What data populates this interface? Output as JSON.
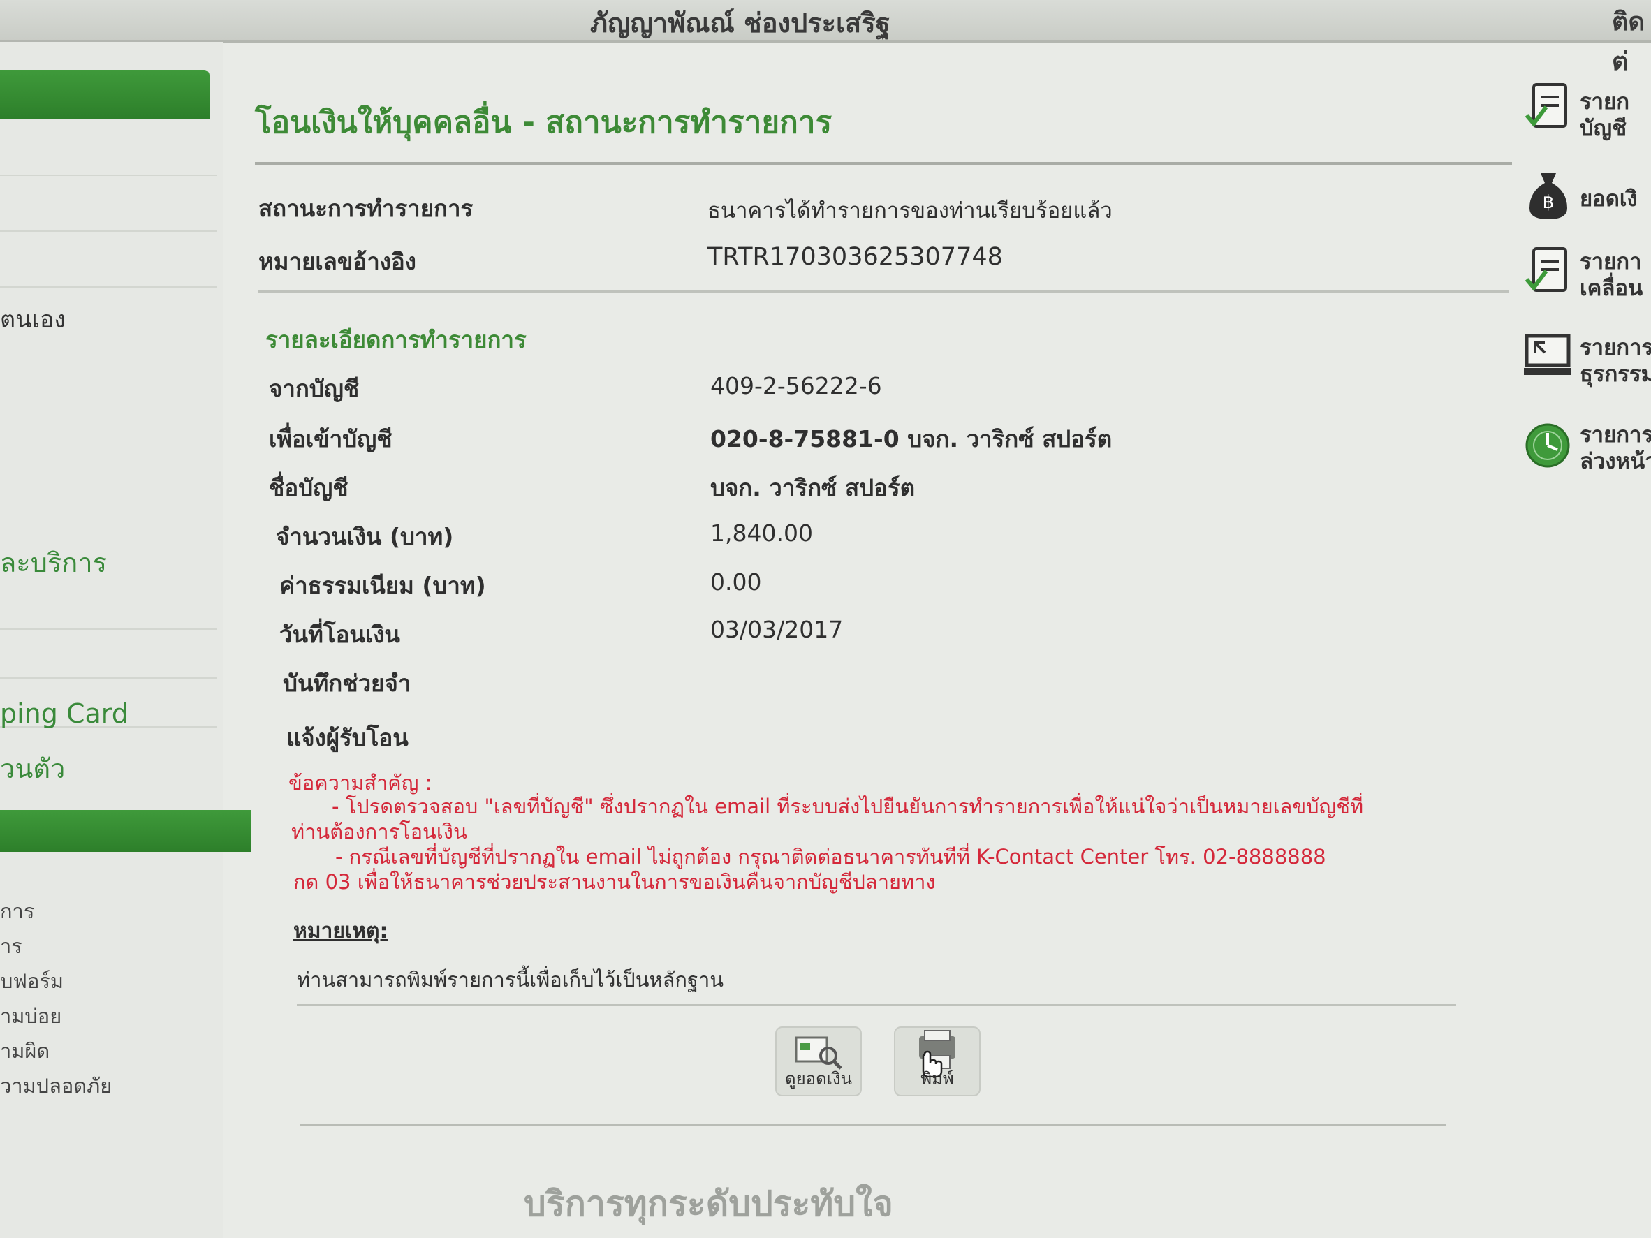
{
  "topbar": {
    "user_name": "ภัญญาพัณณ์ ช่องประเสริฐ",
    "contact": "ติดต่"
  },
  "sidebar": {
    "items": [
      {
        "label": "ตนเอง"
      },
      {
        "label": "ละบริการ"
      },
      {
        "label": "ping Card"
      },
      {
        "label": "วนตัว"
      },
      {
        "label": "การ"
      },
      {
        "label": "าร"
      },
      {
        "label": "บฟอร์ม"
      },
      {
        "label": "ามบ่อย"
      },
      {
        "label": "ามผิด"
      },
      {
        "label": "วามปลอดภัย"
      }
    ]
  },
  "main": {
    "title": "โอนเงินให้บุคคลอื่น - สถานะการทำรายการ",
    "status_label": "สถานะการทำรายการ",
    "status_value": "ธนาคารได้ทำรายการของท่านเรียบร้อยแล้ว",
    "ref_label": "หมายเลขอ้างอิง",
    "ref_value": "TRTR170303625307748",
    "details_title": "รายละเอียดการทำรายการ",
    "details": [
      {
        "label": "จากบัญชี",
        "value": "409-2-56222-6"
      },
      {
        "label": "เพื่อเข้าบัญชี",
        "value": "020-8-75881-0",
        "value_extra": "บจก. วาริกซ์ สปอร์ต"
      },
      {
        "label": "ชื่อบัญชี",
        "value": "บจก. วาริกซ์ สปอร์ต"
      },
      {
        "label": "จำนวนเงิน (บาท)",
        "value": "1,840.00"
      },
      {
        "label": "ค่าธรรมเนียม (บาท)",
        "value": "0.00"
      },
      {
        "label": "วันที่โอนเงิน",
        "value": "03/03/2017"
      },
      {
        "label": "บันทึกช่วยจำ",
        "value": ""
      },
      {
        "label": "แจ้งผู้รับโอน",
        "value": ""
      }
    ],
    "important_title": "ข้อความสำคัญ :",
    "important_lines": [
      "- โปรดตรวจสอบ \"เลขที่บัญชี\" ซึ่งปรากฏใน email ที่ระบบส่งไปยืนยันการทำรายการเพื่อให้แน่ใจว่าเป็นหมายเลขบัญชีที่",
      "ท่านต้องการโอนเงิน",
      "- กรณีเลขที่บัญชีที่ปรากฏใน email ไม่ถูกต้อง กรุณาติดต่อธนาคารทันทีที่ K-Contact Center โทร. 02-8888888",
      "กด 03 เพื่อให้ธนาคารช่วยประสานงานในการขอเงินคืนจากบัญชีปลายทาง"
    ],
    "note_title": "หมายเหตุ:",
    "note_text": "ท่านสามารถพิมพ์รายการนี้เพื่อเก็บไว้เป็นหลักฐาน",
    "buttons": {
      "view_balance": "ดูยอดเงิน",
      "print": "พิมพ์"
    },
    "footer_slogan": "บริการทุกระดับประทับใจ"
  },
  "right_menu": [
    {
      "line1": "รายก",
      "line2": "บัญชี",
      "icon": "document-check-icon"
    },
    {
      "line1": "ยอดเงิ",
      "line2": "",
      "icon": "money-bag-icon"
    },
    {
      "line1": "รายกา",
      "line2": "เคลื่อน",
      "icon": "document-check-icon"
    },
    {
      "line1": "รายการ",
      "line2": "ธุรกรรม",
      "icon": "monitor-icon"
    },
    {
      "line1": "รายการ",
      "line2": "ล่วงหน้า",
      "icon": "clock-icon"
    }
  ],
  "colors": {
    "accent_green": "#3d8a36",
    "warning_red": "#d4283a",
    "background": "#e9ebe7"
  }
}
